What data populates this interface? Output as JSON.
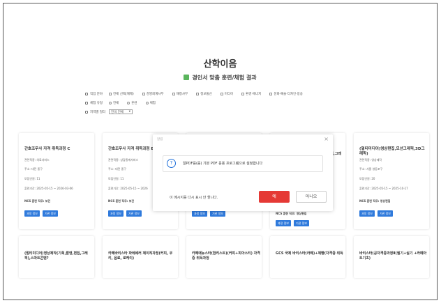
{
  "page": {
    "title": "산학이음",
    "subtitle": "경인서 맞춤 훈련/채험 결과"
  },
  "filters": {
    "field": {
      "label": "직업 분야",
      "options": [
        "전체 선택(해제)",
        "경영회계사무",
        "재정사무",
        "정보통신",
        "미디어",
        "환경·에너지",
        "문화·예술·디자인·방송"
      ]
    },
    "type": {
      "label": "체험 유형",
      "options": [
        "전체",
        "훈련",
        "체험"
      ]
    },
    "region": {
      "label": "지역별 필터",
      "selected": "전국 전체"
    }
  },
  "cards": [
    {
      "title": "간호조무사 자격 취득과정 C",
      "rows": [
        "관련직종: 의료서비스",
        "주소: 대전 중구",
        "모집인원: 11",
        "훈련기간: 2025-05-15 ~ 2026-03-06",
        "NCS 훈련 직무: 보건"
      ],
      "btn_detail": "과정 정보",
      "btn_apply": "기관 정보"
    },
    {
      "title": "간호조무사 자격 취득과정 E",
      "rows": [
        "관련직종: 상담통계서비스",
        "주소: 대전 중구",
        "모집인원: 11",
        "훈련기간: 2025-05-15 ~ 2026",
        "NCS 훈련 직무: 보건"
      ],
      "btn_detail": "과정 정보",
      "btn_apply": "기관 정보"
    },
    {
      "title": "",
      "rows": [],
      "btn_detail": "과정 정보",
      "btn_apply": "기관 정보"
    },
    {
      "title": "",
      "rows": [
        "NCS 훈련 직무: 영상편집"
      ],
      "btn_detail": "과정 정보",
      "btn_apply": "기관 정보"
    },
    {
      "title": "(멀티미디어)영상편집,모션그래픽,3D그래픽)",
      "rows": [
        "관련직종: 영상제작",
        "주소: 서울 영등포구",
        "모집인원: 20",
        "훈련기간: 2025-05-15 ~ 2025-10-17",
        "NCS 훈련 직무: 영상편집"
      ],
      "btn_detail": "과정 정보",
      "btn_apply": "기관 정보"
    }
  ],
  "card_clip_title": "실기,그래",
  "bottom_cards": [
    "(멀티미디어)영상제작(기획,촬영,편집,그래픽),스마트콘텐?",
    "카페바리스타 파테쉐러 제이직과정(커피, 쿠키, 음료, 로케이)",
    "카페매뉴스타(합리스트)(커피+피아스티) 자격증 취득과정",
    "GCS 국제 바리스타(라떼)+제빵(자격증 취득",
    "바리스타(공자격증과정Ⅱ(필기+실기 +라떼아트기초)"
  ],
  "modal": {
    "header": "알림",
    "message": "알PDF를(를) 기본 PDF 응용 프로그램으로 설정합니다",
    "question": "이 메시지를 다시 표시 안 할니다.",
    "yes": "예",
    "no": "아니오"
  },
  "colors": {
    "primary": "#1e6fd9",
    "danger": "#e53935",
    "check": "#4caf50"
  }
}
